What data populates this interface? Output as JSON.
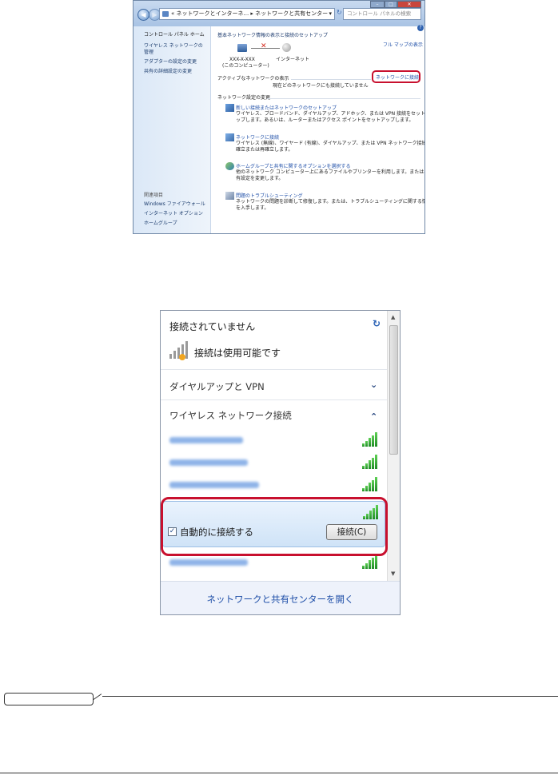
{
  "window1": {
    "nav_back": "◀",
    "nav_fwd": "▶",
    "address": "« ネットワークとインターネ... ▸ ネットワークと共有センター",
    "address_dropdown": "▾",
    "refresh": "↻",
    "search_placeholder": "コントロール パネルの検索",
    "caption": {
      "min": "–",
      "max": "□",
      "close": "✕"
    },
    "help": "?",
    "sidebar": {
      "home": "コントロール パネル ホーム",
      "items": [
        "ワイヤレス ネットワークの管理",
        "アダプターの設定の変更",
        "共有の詳細設定の変更"
      ],
      "related_heading": "関連項目",
      "related": [
        "Windows ファイアウォール",
        "インターネット オプション",
        "ホームグループ"
      ]
    },
    "main": {
      "heading": "基本ネットワーク情報の表示と接続のセットアップ",
      "full_map": "フル マップの表示",
      "computer_name": "XXX-X-XXX",
      "computer_sub": "(このコンピューター)",
      "internet": "インターネット",
      "active_heading": "アクティブなネットワークの表示",
      "connect_link": "ネットワークに接続",
      "no_network": "現在どのネットワークにも接続していません",
      "change_heading": "ネットワーク設定の変更",
      "tasks": [
        {
          "title": "新しい接続またはネットワークのセットアップ",
          "desc1": "ワイヤレス、ブロードバンド、ダイヤルアップ、アドホック、または VPN 接続をセットア",
          "desc2": "ップします。あるいは、ルーターまたはアクセス ポイントをセットアップします。"
        },
        {
          "title": "ネットワークに接続",
          "desc1": "ワイヤレス (無線)、ワイヤード (有線)、ダイヤルアップ、または VPN ネットワーク接続を",
          "desc2": "確立または再確立します。"
        },
        {
          "title": "ホームグループと共有に関するオプションを選択する",
          "desc1": "他のネットワーク コンピューター上にあるファイルやプリンターを利用します。または、共",
          "desc2": "有設定を変更します。"
        },
        {
          "title": "問題のトラブルシューティング",
          "desc1": "ネットワークの問題を診断して修復します。または、トラブルシューティングに関する情報",
          "desc2": "を入手します。"
        }
      ]
    }
  },
  "window2": {
    "status_title": "接続されていません",
    "connections_available": "接続は使用可能です",
    "dialup_vpn": "ダイヤルアップと VPN",
    "wireless_heading": "ワイヤレス ネットワーク接続",
    "auto_connect_label": "自動的に接続する",
    "connect_button": "接続(C)",
    "footer_link": "ネットワークと共有センターを開く",
    "network_signal_bars": [
      5,
      5,
      5,
      5,
      5
    ]
  },
  "colors": {
    "highlight_red": "#c8102e",
    "link_blue": "#1f4fa8",
    "signal_green": "#2f9e2f"
  }
}
